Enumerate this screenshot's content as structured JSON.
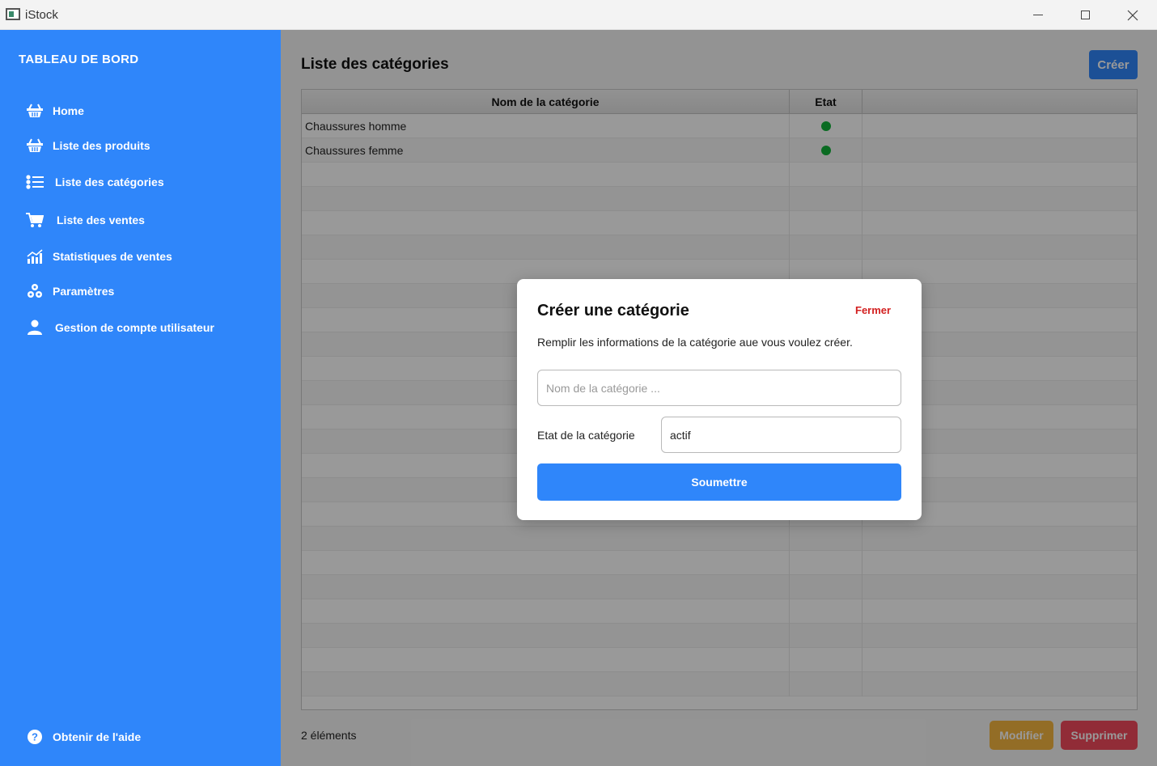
{
  "window": {
    "title": "iStock"
  },
  "sidebar": {
    "brand": "TABLEAU DE BORD",
    "items": [
      {
        "label": "Home",
        "icon": "basket-icon"
      },
      {
        "label": "Liste des produits",
        "icon": "basket-icon"
      },
      {
        "label": "Liste des catégories",
        "icon": "list-icon"
      },
      {
        "label": "Liste des ventes",
        "icon": "cart-icon"
      },
      {
        "label": "Statistiques de ventes",
        "icon": "chart-icon"
      },
      {
        "label": "Paramètres",
        "icon": "cogs-icon"
      },
      {
        "label": "Gestion de compte utilisateur",
        "icon": "user-icon"
      }
    ],
    "help": {
      "label": "Obtenir de l'aide",
      "icon": "help-icon"
    }
  },
  "main": {
    "title": "Liste des catégories",
    "create_label": "Créer",
    "table": {
      "columns": [
        "Nom de la catégorie",
        "Etat"
      ],
      "rows": [
        {
          "name": "Chaussures homme",
          "state": "active"
        },
        {
          "name": "Chaussures femme",
          "state": "active"
        }
      ]
    },
    "count_label": "2 éléments",
    "edit_label": "Modifier",
    "delete_label": "Supprimer"
  },
  "modal": {
    "title": "Créer une catégorie",
    "close_label": "Fermer",
    "description": "Remplir les informations de la catégorie aue vous voulez créer.",
    "name_placeholder": "Nom de la catégorie ...",
    "name_value": "",
    "state_label": "Etat de la catégorie",
    "state_value": "actif",
    "submit_label": "Soumettre"
  },
  "colors": {
    "accent": "#2f86fa",
    "active_dot": "#12b23a",
    "edit": "#f5b640",
    "delete": "#f24a5c",
    "close_text": "#d32020"
  }
}
